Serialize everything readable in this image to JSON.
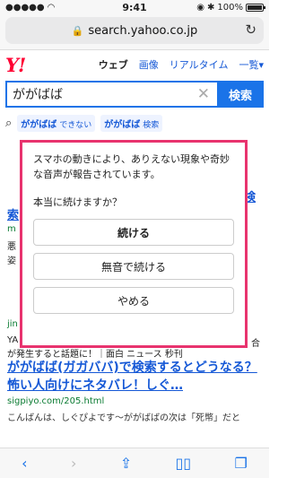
{
  "status": {
    "time": "9:41",
    "battery": "100%"
  },
  "browser": {
    "url": "search.yahoo.co.jp"
  },
  "header": {
    "logo": "Y!",
    "tabs": [
      {
        "label": "ウェブ"
      },
      {
        "label": "画像"
      },
      {
        "label": "リアルタイム"
      },
      {
        "label": "一覧"
      }
    ]
  },
  "search": {
    "value": "ががばば",
    "button": "検索"
  },
  "suggestions": [
    {
      "word": "ががばば",
      "extra": "できない"
    },
    {
      "word": "ががばば",
      "extra": "検索"
    }
  ],
  "popup": {
    "message": "スマホの動きにより、ありえない現象や奇妙な音声が報告されています。",
    "question": "本当に続けますか？",
    "buttons": [
      "続ける",
      "無音で続ける",
      "やめる"
    ]
  },
  "results": {
    "fragments": {
      "r1_url": "m",
      "r1_snip": "悪",
      "r1_snip2": "姿",
      "r1_suffix1": "検",
      "r1_suffix2": "索",
      "r2_url": "jin",
      "r2_snip": "YA",
      "r2_suffix": "合",
      "r2_line": "が発生すると話題に！｜面白 ニュース 秒刊"
    },
    "main": {
      "title": "ががばば(ガガババ)で検索するとどうなる？怖い人向けにネタバレ！しぐ…",
      "url": "sigpiyo.com/205.html",
      "snippet": "こんばんは、しぐぴよです～ががばばの次は「死幣」だと"
    }
  }
}
